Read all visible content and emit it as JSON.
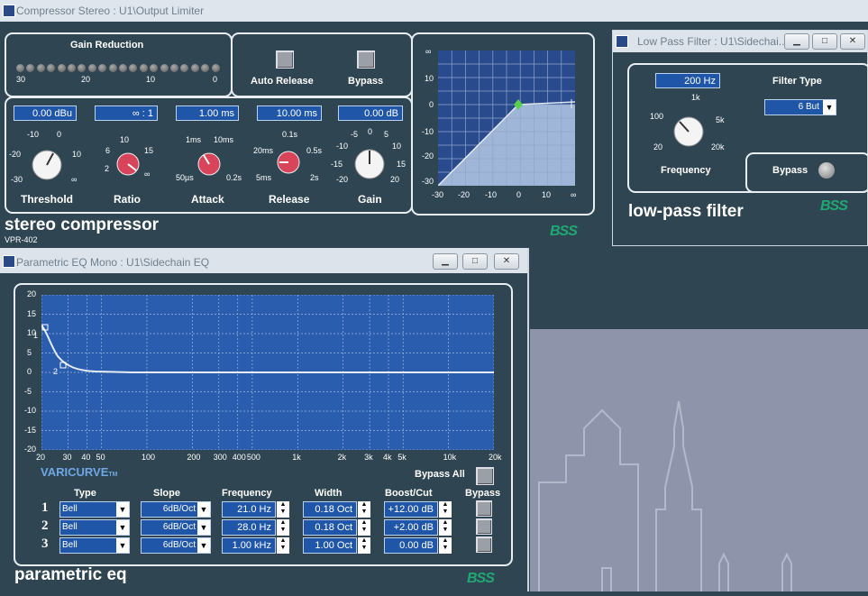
{
  "compressor": {
    "title": "Compressor Stereo : U1\\Output Limiter",
    "gain_reduction_label": "Gain Reduction",
    "gr_scale": [
      "30",
      "20",
      "10",
      "0"
    ],
    "auto_release": "Auto Release",
    "bypass": "Bypass",
    "fields": {
      "threshold": "0.00 dBu",
      "ratio": "∞ : 1",
      "attack": "1.00 ms",
      "release": "10.00 ms",
      "gain": "0.00 dB"
    },
    "labels": {
      "threshold": "Threshold",
      "ratio": "Ratio",
      "attack": "Attack",
      "release": "Release",
      "gain": "Gain"
    },
    "knob_scales": {
      "threshold": [
        "-10",
        "0",
        "-20",
        "10",
        "-30",
        "∞"
      ],
      "ratio": [
        "10",
        "6",
        "15",
        "2",
        "∞"
      ],
      "attack": [
        "1ms",
        "10ms",
        "50µs",
        "0.2s"
      ],
      "release": [
        "0.1s",
        "20ms",
        "0.5s",
        "5ms",
        "2s"
      ],
      "gain": [
        "-5",
        "0",
        "5",
        "-10",
        "10",
        "-15",
        "15",
        "-20",
        "20"
      ]
    },
    "graph_y": [
      "∞",
      "10",
      "0",
      "-10",
      "-20",
      "-30"
    ],
    "graph_x": [
      "-30",
      "-20",
      "-10",
      "0",
      "10",
      "∞"
    ],
    "name": "stereo compressor",
    "model": "VPR-402"
  },
  "lpf": {
    "title": "Low Pass Filter : U1\\Sidechai...",
    "freq_value": "200 Hz",
    "freq_scale": [
      "1k",
      "100",
      "5k",
      "20",
      "20k"
    ],
    "frequency_label": "Frequency",
    "filter_type_label": "Filter Type",
    "filter_type_value": "6 But",
    "bypass": "Bypass",
    "name": "low-pass filter"
  },
  "peq": {
    "title": "Parametric EQ Mono : U1\\Sidechain EQ",
    "y_ticks": [
      "20",
      "15",
      "10",
      "5",
      "0",
      "-5",
      "-10",
      "-15",
      "-20"
    ],
    "x_ticks": [
      "20",
      "30",
      "40",
      "50",
      "100",
      "200",
      "300",
      "400",
      "500",
      "1k",
      "2k",
      "3k",
      "4k",
      "5k",
      "10k",
      "20k"
    ],
    "varicurve": "VARICURVE",
    "tm": "TM",
    "bypass_all": "Bypass All",
    "headers": {
      "type": "Type",
      "slope": "Slope",
      "frequency": "Frequency",
      "width": "Width",
      "boost": "Boost/Cut",
      "bypass": "Bypass"
    },
    "bands": [
      {
        "num": "1",
        "type": "Bell",
        "slope": "6dB/Oct",
        "freq": "21.0 Hz",
        "width": "0.18 Oct",
        "gain": "+12.00 dB"
      },
      {
        "num": "2",
        "type": "Bell",
        "slope": "6dB/Oct",
        "freq": "28.0 Hz",
        "width": "0.18 Oct",
        "gain": "+2.00 dB"
      },
      {
        "num": "3",
        "type": "Bell",
        "slope": "6dB/Oct",
        "freq": "1.00 kHz",
        "width": "1.00 Oct",
        "gain": "0.00 dB"
      }
    ],
    "marker_1": "1",
    "marker_2": "2",
    "name": "parametric eq"
  },
  "logo": "BSS",
  "colors": {
    "panel_bg": "#2f4652",
    "field_blue": "#1f56a8",
    "graph_blue": "#2a5dad",
    "accent_green": "#1fa873",
    "red_knob": "#d8445a"
  }
}
